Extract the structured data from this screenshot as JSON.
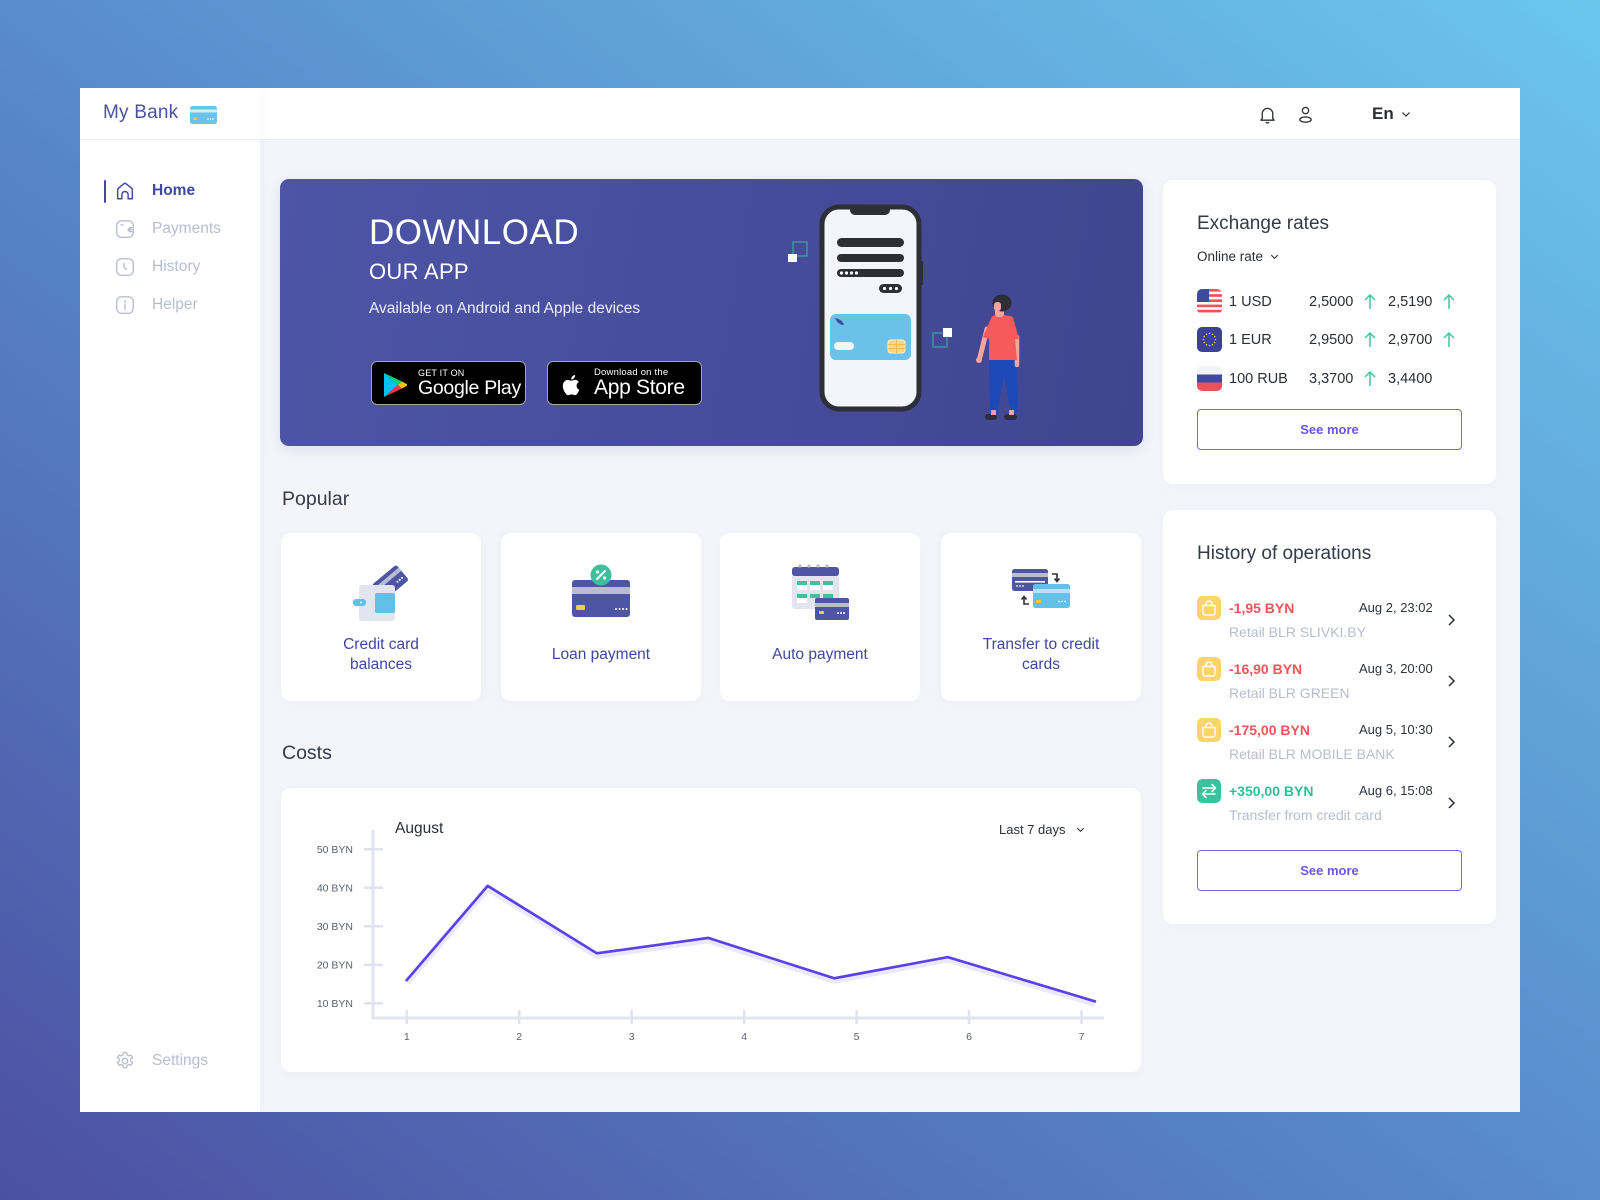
{
  "app": {
    "title": "My Bank",
    "logo_icon": "credit-card-icon"
  },
  "sidebar": {
    "items": [
      {
        "label": "Home",
        "icon": "home-icon",
        "active": true
      },
      {
        "label": "Payments",
        "icon": "wallet-icon",
        "active": false
      },
      {
        "label": "History",
        "icon": "clock-icon",
        "active": false
      },
      {
        "label": "Helper",
        "icon": "info-icon",
        "active": false
      }
    ],
    "settings": {
      "label": "Settings",
      "icon": "gear-icon"
    }
  },
  "header": {
    "language": "En",
    "icons": [
      "bell-icon",
      "user-icon"
    ]
  },
  "banner": {
    "title": "DOWNLOAD",
    "subtitle": "OUR APP",
    "description": "Available on Android and Apple devices",
    "google_play": {
      "top": "GET IT ON",
      "bottom": "Google Play"
    },
    "app_store": {
      "top": "Download on the",
      "bottom": "App Store"
    }
  },
  "popular": {
    "title": "Popular",
    "items": [
      {
        "lines": [
          "Credit card",
          "balances"
        ],
        "icon": "wallet-card-icon"
      },
      {
        "lines": [
          "Loan payment"
        ],
        "icon": "loan-card-icon"
      },
      {
        "lines": [
          "Auto payment"
        ],
        "icon": "calendar-card-icon"
      },
      {
        "lines": [
          "Transfer to credit",
          "cards"
        ],
        "icon": "card-transfer-icon"
      }
    ]
  },
  "costs": {
    "title": "Costs",
    "month": "August",
    "period": "Last 7 days"
  },
  "chart_data": {
    "type": "line",
    "title": "August",
    "xlabel": "",
    "ylabel": "",
    "xticks": [
      1,
      2,
      3,
      4,
      5,
      6,
      7
    ],
    "xtick_labels": [
      "1",
      "2",
      "3",
      "4",
      "5",
      "6",
      "7"
    ],
    "yticks": [
      10,
      20,
      30,
      40,
      50
    ],
    "ytick_labels": [
      "10 BYN",
      "20 BYN",
      "30 BYN",
      "40 BYN",
      "50 BYN"
    ],
    "xlim": [
      0.7,
      7.2
    ],
    "ylim": [
      6.2,
      55
    ],
    "grid": false,
    "legend": "none",
    "series": [
      {
        "name": "Costs",
        "x": [
          1,
          1.72,
          2.69,
          3.68,
          4.8,
          5.81,
          7.12
        ],
        "values": [
          16,
          40.5,
          23,
          27,
          16.5,
          22,
          10.5
        ]
      }
    ]
  },
  "exchange": {
    "title": "Exchange rates",
    "rate_type": "Online rate",
    "rows": [
      {
        "currency": "1 USD",
        "flag": "us-flag-icon",
        "buy": "2,5000",
        "buy_trend": "up",
        "sell": "2,5190",
        "sell_trend": "up"
      },
      {
        "currency": "1 EUR",
        "flag": "eu-flag-icon",
        "buy": "2,9500",
        "buy_trend": "up",
        "sell": "2,9700",
        "sell_trend": "up"
      },
      {
        "currency": "100 RUB",
        "flag": "ru-flag-icon",
        "buy": "3,3700",
        "buy_trend": "up",
        "sell": "3,4400",
        "sell_trend": null
      }
    ],
    "see_more": "See more"
  },
  "history": {
    "title": "History of operations",
    "items": [
      {
        "amount": "-1,95 BYN",
        "date": "Aug 2, 23:02",
        "description": "Retail BLR SLIVKI.BY",
        "icon": "shopping-bag-icon",
        "direction": "out"
      },
      {
        "amount": "-16,90 BYN",
        "date": "Aug 3, 20:00",
        "description": "Retail BLR GREEN",
        "icon": "shopping-bag-icon",
        "direction": "out"
      },
      {
        "amount": "-175,00 BYN",
        "date": "Aug 5, 10:30",
        "description": "Retail BLR MOBILE BANK",
        "icon": "shopping-bag-icon",
        "direction": "out"
      },
      {
        "amount": "+350,00 BYN",
        "date": "Aug 6, 15:08",
        "description": "Transfer from credit card",
        "icon": "transfer-arrows-icon",
        "direction": "in"
      }
    ],
    "see_more": "See more"
  },
  "colors": {
    "brand": "#4b53a1",
    "banner": "#474d9c",
    "chart_line": "#5b3fe8",
    "negative": "#f2545b",
    "positive": "#33bf96",
    "trend_up": "#3cc79f",
    "button_border": "#7a66f0"
  }
}
